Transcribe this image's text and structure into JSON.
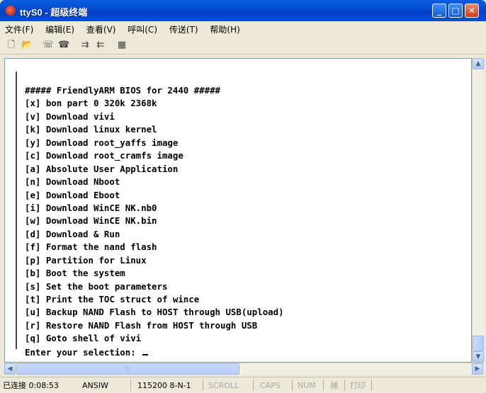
{
  "window": {
    "title": "ttyS0 - 超级终端",
    "minimize_glyph": "_",
    "maximize_glyph": "□",
    "close_glyph": "✕"
  },
  "menu": [
    {
      "label": "文件(F)"
    },
    {
      "label": "编辑(E)"
    },
    {
      "label": "查看(V)"
    },
    {
      "label": "呼叫(C)"
    },
    {
      "label": "传送(T)"
    },
    {
      "label": "帮助(H)"
    }
  ],
  "toolbar": [
    {
      "icon": "new-file-icon",
      "glyph": "🗋"
    },
    {
      "icon": "open-folder-icon",
      "glyph": "📂"
    },
    {
      "icon": "connect-icon",
      "glyph": "☏"
    },
    {
      "icon": "disconnect-icon",
      "glyph": "☎"
    },
    {
      "icon": "send-icon",
      "glyph": "⇉"
    },
    {
      "icon": "receive-icon",
      "glyph": "⇇"
    },
    {
      "icon": "properties-icon",
      "glyph": "▦"
    }
  ],
  "terminal": {
    "lines": [
      "##### FriendlyARM BIOS for 2440 #####",
      "[x] bon part 0 320k 2368k",
      "[v] Download vivi",
      "[k] Download linux kernel",
      "[y] Download root_yaffs image",
      "[c] Download root_cramfs image",
      "[a] Absolute User Application",
      "[n] Download Nboot",
      "[e] Download Eboot",
      "[i] Download WinCE NK.nb0",
      "[w] Download WinCE NK.bin",
      "[d] Download & Run",
      "[f] Format the nand flash",
      "[p] Partition for Linux",
      "[b] Boot the system",
      "[s] Set the boot parameters",
      "[t] Print the TOC struct of wince",
      "[u] Backup NAND Flash to HOST through USB(upload)",
      "[r] Restore NAND Flash from HOST through USB",
      "[q] Goto shell of vivi"
    ],
    "prompt": "Enter your selection: "
  },
  "status": {
    "connection": "已连接 0:08:53",
    "emulation": "ANSIW",
    "port_settings": "115200 8-N-1",
    "scroll": "SCROLL",
    "caps": "CAPS",
    "num": "NUM",
    "capture": "捕",
    "print": "打印"
  }
}
